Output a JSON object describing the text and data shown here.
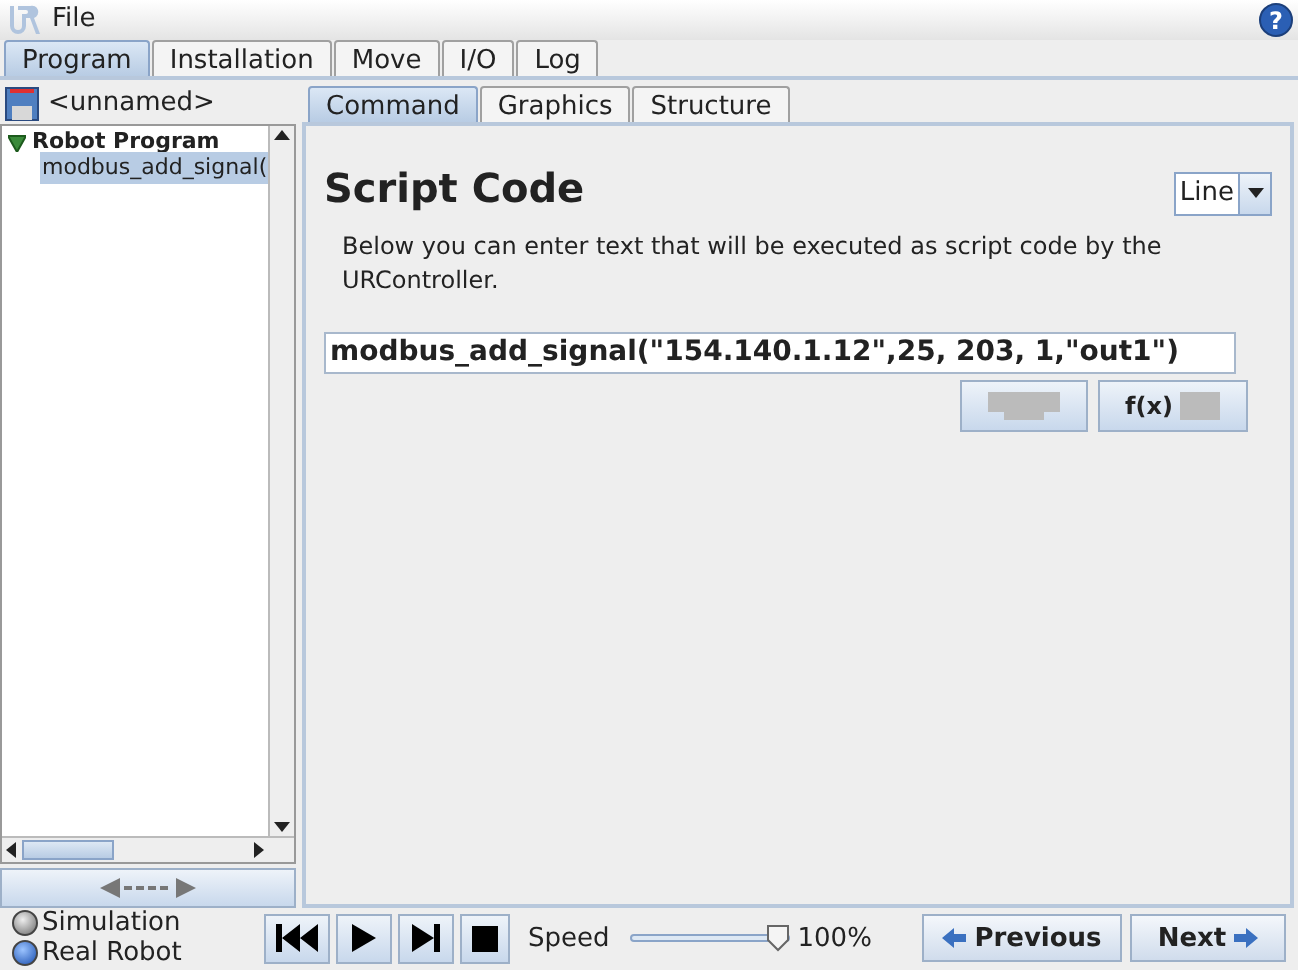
{
  "menu": [
    "File"
  ],
  "help": "?",
  "tabs": [
    {
      "label": "Program",
      "selected": true
    },
    {
      "label": "Installation",
      "selected": false
    },
    {
      "label": "Move",
      "selected": false
    },
    {
      "label": "I/O",
      "selected": false
    },
    {
      "label": "Log",
      "selected": false
    }
  ],
  "program_name": "<unnamed>",
  "tree": [
    {
      "label": "Robot Program",
      "expanded": true,
      "selected": false,
      "children": [
        {
          "label": "modbus_add_signal(",
          "selected": true
        }
      ]
    }
  ],
  "subtabs": [
    {
      "label": "Command",
      "selected": true
    },
    {
      "label": "Graphics",
      "selected": false
    },
    {
      "label": "Structure",
      "selected": false
    }
  ],
  "panel": {
    "title": "Script Code",
    "mode": "Line",
    "description": "Below you can enter text that will be executed as script code by the URController.",
    "code": "modbus_add_signal(\"154.140.1.12\",25, 203, 1,\"out1\")",
    "fx_button": "f(x)"
  },
  "robot_mode": [
    {
      "label": "Simulation",
      "selected": false
    },
    {
      "label": "Real Robot",
      "selected": true
    }
  ],
  "speed": {
    "label": "Speed",
    "level": 1.0,
    "reading": "100%"
  },
  "nav": {
    "previous": "Previous",
    "next": "Next"
  }
}
